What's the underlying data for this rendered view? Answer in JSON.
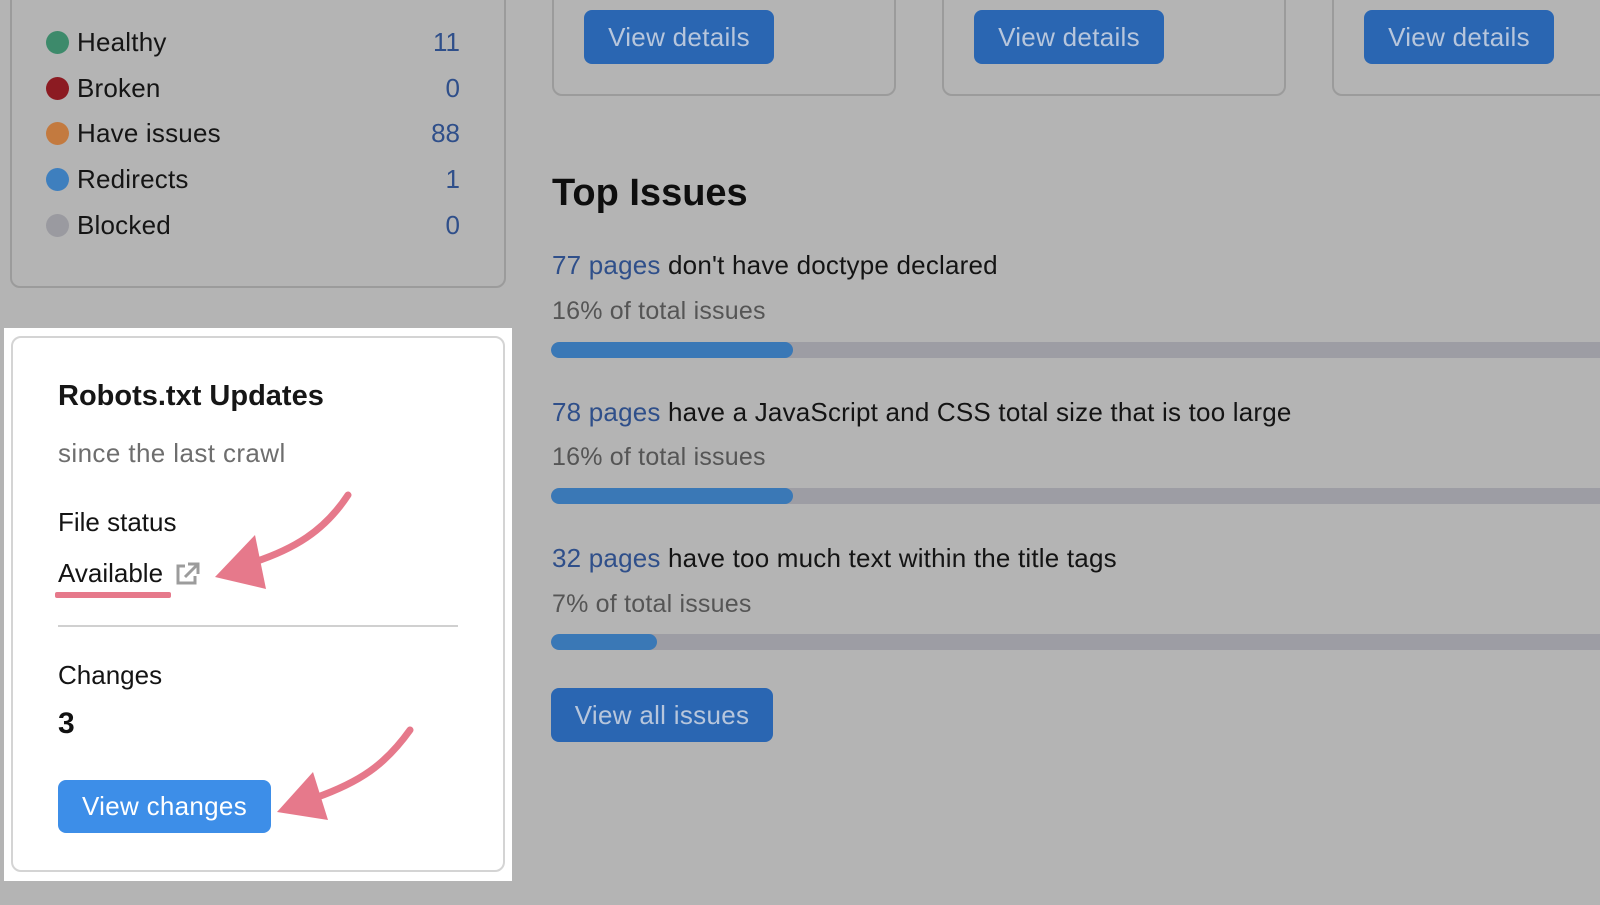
{
  "status_summary": {
    "items": [
      {
        "label": "Healthy",
        "value": "11",
        "color": "#3d8a6b"
      },
      {
        "label": "Broken",
        "value": "0",
        "color": "#8c1b22"
      },
      {
        "label": "Have issues",
        "value": "88",
        "color": "#c37a3f"
      },
      {
        "label": "Redirects",
        "value": "1",
        "color": "#3e7fbe"
      },
      {
        "label": "Blocked",
        "value": "0",
        "color": "#9a9aa0"
      }
    ]
  },
  "detail_cards": [
    {
      "button_label": "View details"
    },
    {
      "button_label": "View details"
    },
    {
      "button_label": "View details"
    }
  ],
  "top_issues": {
    "title": "Top Issues",
    "items": [
      {
        "count_link": "77 pages",
        "text": " don't have doctype declared",
        "percent_label": "16% of total issues",
        "share": 0.16
      },
      {
        "count_link": "78 pages",
        "text": " have a JavaScript and CSS total size that is too large",
        "percent_label": "16% of total issues",
        "share": 0.16
      },
      {
        "count_link": "32 pages",
        "text": " have too much text within the title tags",
        "percent_label": "7% of total issues",
        "share": 0.07
      }
    ],
    "view_all_label": "View all issues"
  },
  "robots": {
    "title": "Robots.txt Updates",
    "subtitle": "since the last crawl",
    "file_status_label": "File status",
    "file_status_value": "Available",
    "changes_label": "Changes",
    "changes_value": "3",
    "view_changes_label": "View changes"
  },
  "colors": {
    "accent_blue": "#3d8ee8",
    "annotation_pink": "#e6798b",
    "link_blue": "#2f4f8a"
  }
}
